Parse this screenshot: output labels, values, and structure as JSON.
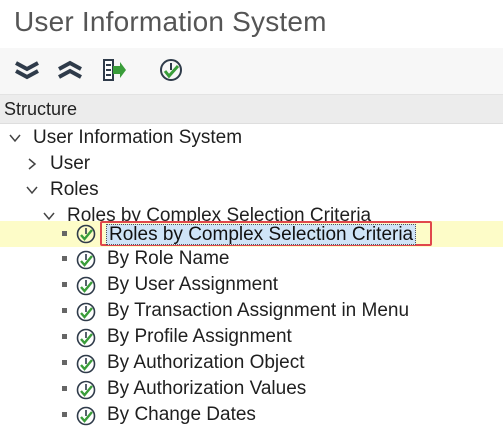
{
  "window": {
    "title": "User Information System"
  },
  "toolbar": {
    "buttons": [
      {
        "icon": "expand-all-icon"
      },
      {
        "icon": "collapse-all-icon"
      },
      {
        "icon": "select-subtree-icon"
      },
      {
        "icon": "execute-clock-icon"
      }
    ]
  },
  "structure": {
    "header": "Structure"
  },
  "tree": {
    "root": "User Information System",
    "user": "User",
    "roles": "Roles",
    "roles_complex": "Roles by Complex Selection Criteria",
    "items": [
      "Roles by Complex Selection Criteria",
      "By Role Name",
      "By User Assignment",
      "By Transaction Assignment in Menu",
      "By Profile Assignment",
      "By Authorization Object",
      "By Authorization Values",
      "By Change Dates"
    ]
  },
  "colors": {
    "selection_row": "#fdfcc8",
    "selection_border": "#e0474c",
    "icon_green": "#3a9d3a",
    "toolbar_dark": "#2f3b4a"
  }
}
